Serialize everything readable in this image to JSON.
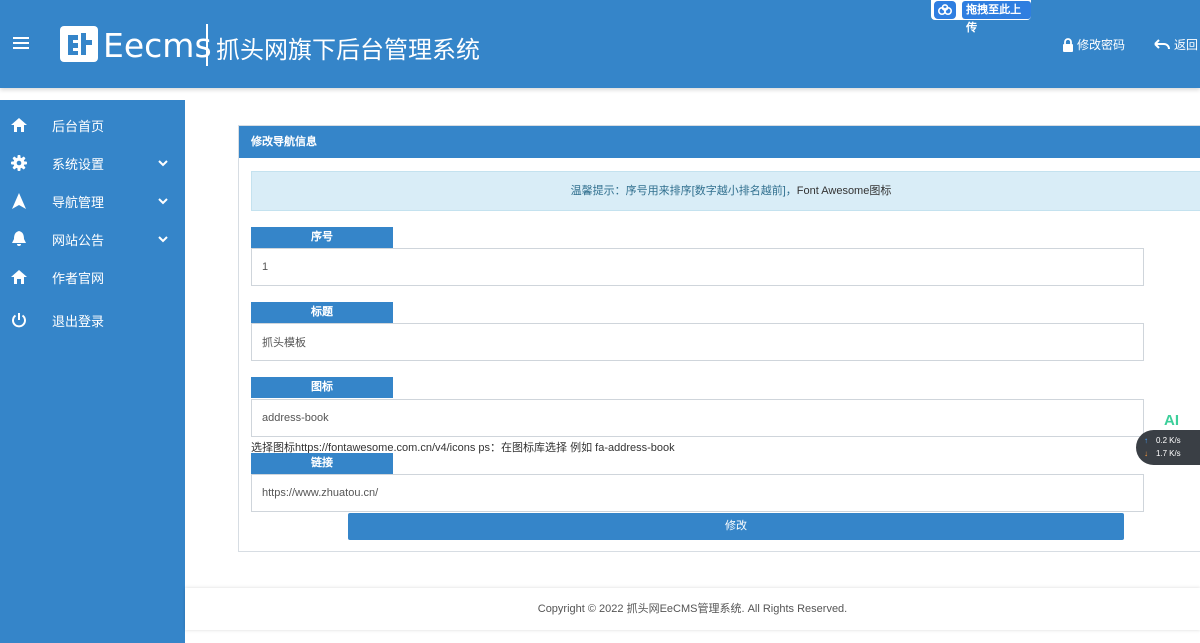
{
  "header": {
    "brand": "Eecms",
    "subtitle": "抓头网旗下后台管理系统",
    "upload_badge": "拖拽至此上传",
    "change_password": "修改密码",
    "back": "返回"
  },
  "sidebar": {
    "items": [
      {
        "label": "后台首页",
        "icon": "home-icon",
        "has_submenu": false
      },
      {
        "label": "系统设置",
        "icon": "gear-icon",
        "has_submenu": true
      },
      {
        "label": "导航管理",
        "icon": "navigation-arrow-icon",
        "has_submenu": true
      },
      {
        "label": "网站公告",
        "icon": "bell-icon",
        "has_submenu": true
      },
      {
        "label": "作者官网",
        "icon": "home-icon",
        "has_submenu": false
      },
      {
        "label": "退出登录",
        "icon": "power-icon",
        "has_submenu": false
      }
    ]
  },
  "panel": {
    "title": "修改导航信息",
    "tip_prefix": "温馨提示：序号用来排序[数字越小排名越前]，",
    "tip_suffix": "Font Awesome图标",
    "fields": [
      {
        "label": "序号",
        "value": "1"
      },
      {
        "label": "标题",
        "value": "抓头模板"
      },
      {
        "label": "图标",
        "value": "address-book"
      },
      {
        "label": "链接",
        "value": "https://www.zhuatou.cn/"
      }
    ],
    "icon_help": "选择图标https://fontawesome.com.cn/v4/icons  ps：在图标库选择 例如 fa-address-book",
    "submit_label": "修改"
  },
  "footer": {
    "copyright": "Copyright © 2022 抓头网EeCMS管理系统. All Rights Reserved."
  },
  "overlay": {
    "ai_label": "AI",
    "upload_speed": "0.2",
    "download_speed": "1.7",
    "speed_unit": "K/s"
  },
  "colors": {
    "primary": "#3585c9",
    "tip_bg": "#d9edf7",
    "tip_text": "#31708f"
  }
}
